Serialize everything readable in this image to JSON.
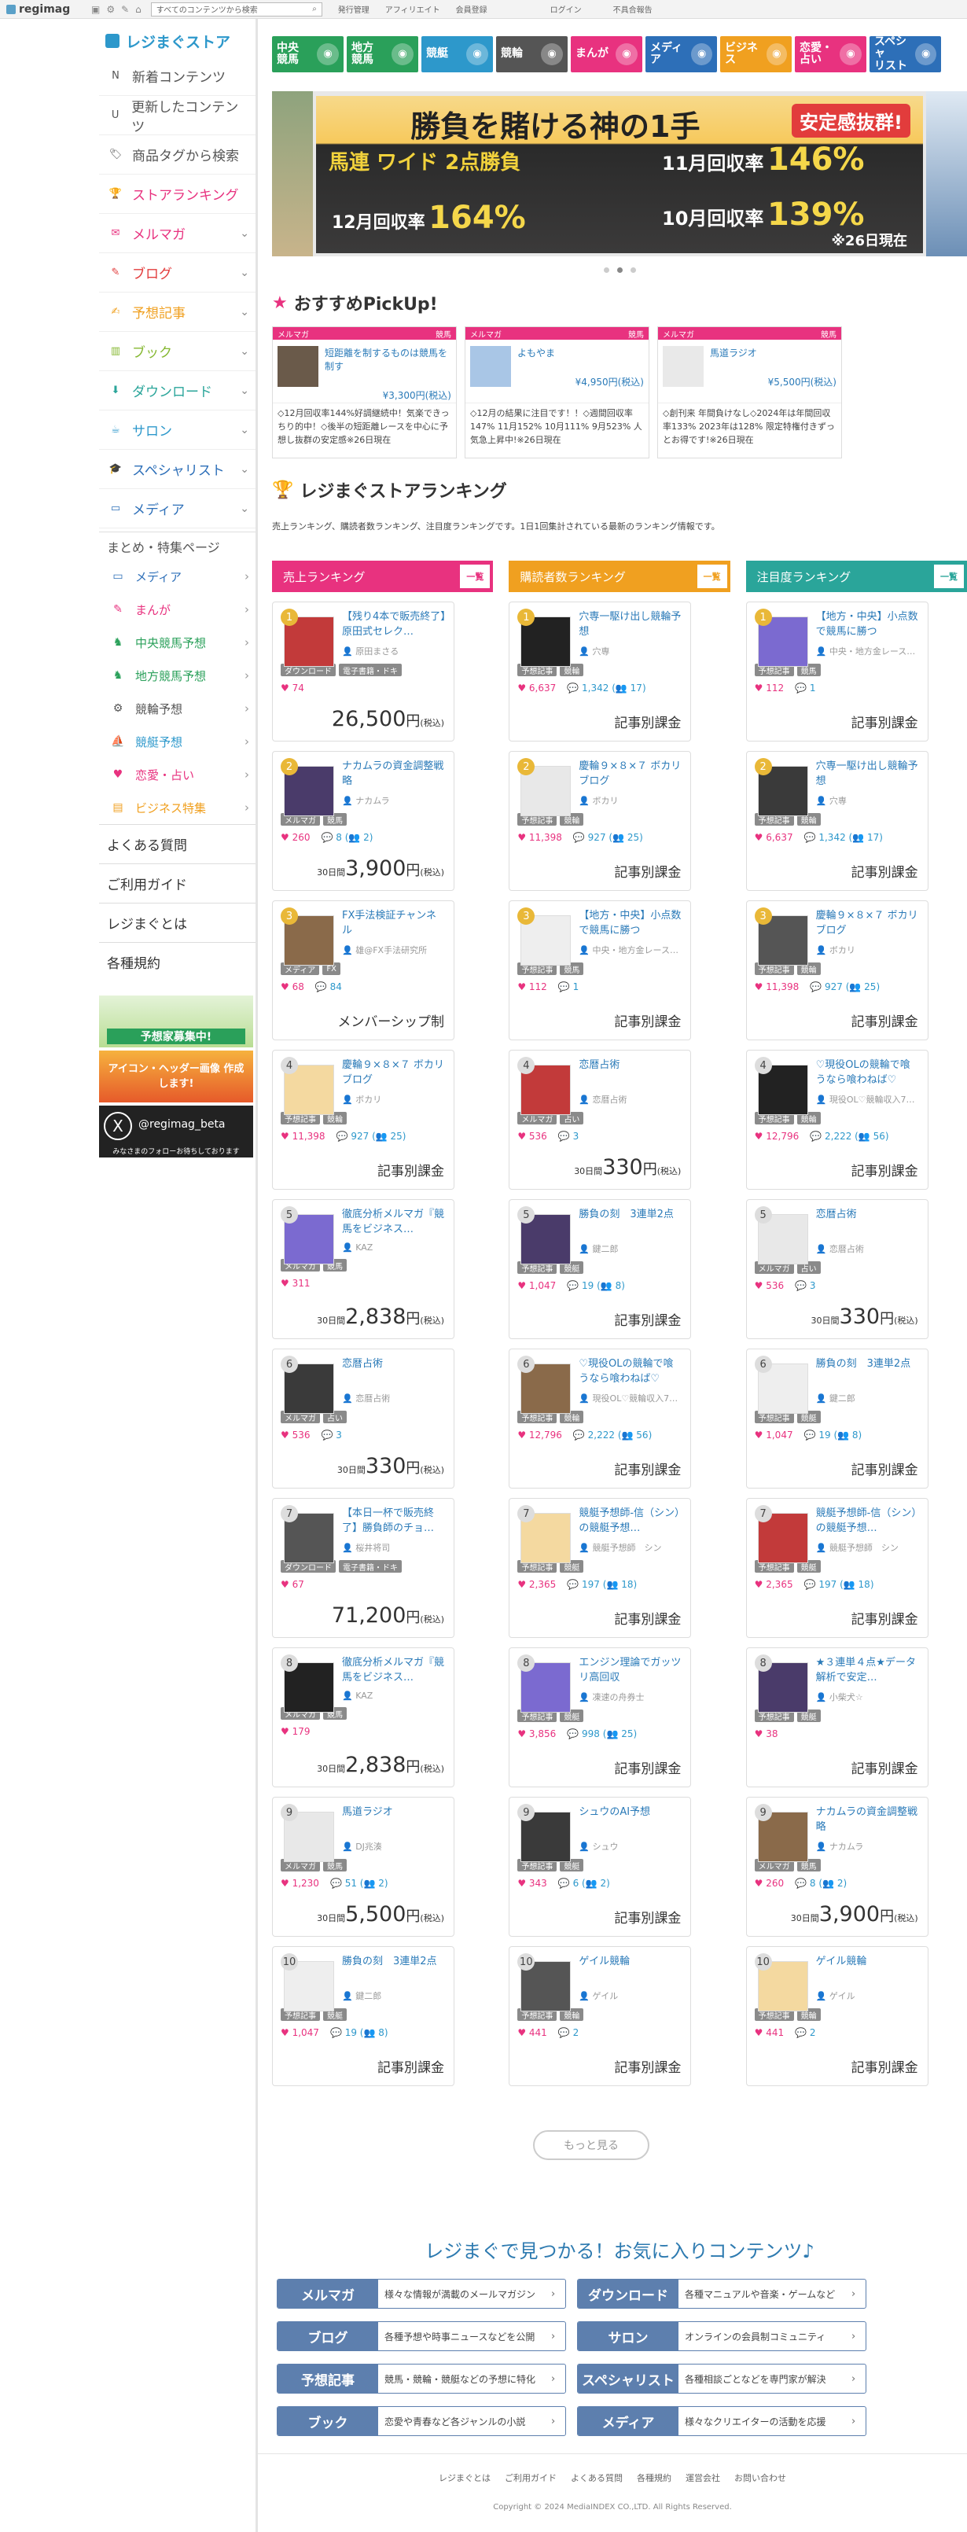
{
  "topbar": {
    "brand": "regimag",
    "search_placeholder": "すべてのコンテンツから検索",
    "links": [
      "発行管理",
      "アフィリエイト",
      "会員登録"
    ],
    "right": [
      "ログイン",
      "不具合報告"
    ]
  },
  "sidebar": {
    "logo": "レジまぐストア",
    "items": [
      {
        "label": "新着コンテンツ",
        "icon": "new-icon",
        "color": "#555"
      },
      {
        "label": "更新したコンテンツ",
        "icon": "update-icon",
        "color": "#555"
      },
      {
        "label": "商品タグから検索",
        "icon": "tag-icon",
        "color": "#555"
      },
      {
        "label": "ストアランキング",
        "icon": "trophy-icon",
        "color": "#e8327f"
      },
      {
        "label": "メルマガ",
        "icon": "mail-icon",
        "color": "#e8327f"
      },
      {
        "label": "ブログ",
        "icon": "pen-icon",
        "color": "#e23c3c"
      },
      {
        "label": "予想記事",
        "icon": "note-icon",
        "color": "#f0a020"
      },
      {
        "label": "ブック",
        "icon": "book-icon",
        "color": "#86b832"
      },
      {
        "label": "ダウンロード",
        "icon": "download-icon",
        "color": "#2aa59a"
      },
      {
        "label": "サロン",
        "icon": "cup-icon",
        "color": "#2d98cb"
      },
      {
        "label": "スペシャリスト",
        "icon": "cap-icon",
        "color": "#2d6fb8"
      },
      {
        "label": "メディア",
        "icon": "monitor-icon",
        "color": "#2d6fb8"
      }
    ],
    "special_heading": "まとめ・特集ページ",
    "special": [
      {
        "label": "メディア",
        "icon": "monitor-icon",
        "color": "#2d6fb8"
      },
      {
        "label": "まんが",
        "icon": "manga-icon",
        "color": "#e8327f"
      },
      {
        "label": "中央競馬予想",
        "icon": "horse-icon",
        "color": "#2aa05a"
      },
      {
        "label": "地方競馬予想",
        "icon": "horse-icon",
        "color": "#2aa05a"
      },
      {
        "label": "競輪予想",
        "icon": "bike-icon",
        "color": "#555"
      },
      {
        "label": "競艇予想",
        "icon": "boat-icon",
        "color": "#2d98cb"
      },
      {
        "label": "恋愛・占い",
        "icon": "heart-icon",
        "color": "#e8327f"
      },
      {
        "label": "ビジネス特集",
        "icon": "briefcase-icon",
        "color": "#f0a020"
      }
    ],
    "plain": [
      "よくある質問",
      "ご利用ガイド",
      "レジまぐとは",
      "各種規約"
    ],
    "banners": [
      "予想家募集中!",
      "アイコン・ヘッダー画像 作成します!",
      "@regimag_beta"
    ],
    "banner_sub": "みなさまのフォローお待ちしております"
  },
  "cats": [
    {
      "label": "中央\n競馬",
      "color": "#2aa05a"
    },
    {
      "label": "地方\n競馬",
      "color": "#2aa05a"
    },
    {
      "label": "競艇",
      "color": "#2d98cb"
    },
    {
      "label": "競輪",
      "color": "#555555"
    },
    {
      "label": "まんが",
      "color": "#e8327f"
    },
    {
      "label": "メディア",
      "color": "#2d6fb8"
    },
    {
      "label": "ビジネス",
      "color": "#f0a020"
    },
    {
      "label": "恋愛・\n占い",
      "color": "#e8327f"
    },
    {
      "label": "スペシャ\nリスト",
      "color": "#2d6fb8"
    }
  ],
  "hero": {
    "headline": "勝負を賭ける神の1手",
    "badge": "安定感抜群!",
    "sub": "馬連 ワイド 2点勝負",
    "s1": "11月回収率",
    "v1": "146%",
    "s2": "12月回収率",
    "v2": "164%",
    "s3": "10月回収率",
    "v3": "139%",
    "note": "※26日現在"
  },
  "pickup": {
    "title": "おすすめPickUp!",
    "items": [
      {
        "type": "メルマガ",
        "cat": "競馬",
        "title": "短距離を制するものは競馬を制す",
        "price": "¥3,300円(税込)",
        "desc": "◇12月回収率144%好調継続中！気楽できっちり的中！◇後半の短距離レースを中心に予想し抜群の安定感※26日現在"
      },
      {
        "type": "メルマガ",
        "cat": "競馬",
        "title": "よもやま",
        "price": "¥4,950円(税込)",
        "desc": "◇12月の結果に注目です！！◇週間回収率147% 11月152% 10月111% 9月523% 人気急上昇中!※26日現在"
      },
      {
        "type": "メルマガ",
        "cat": "競馬",
        "title": "馬道ラジオ",
        "price": "¥5,500円(税込)",
        "desc": "◇創刊来 年間負けなし◇2024年は年間回収率133% 2023年は128% 限定特権付きずっとお得です!※26日現在"
      }
    ]
  },
  "ranking": {
    "title": "レジまぐストアランキング",
    "desc": "売上ランキング、購読者数ランキング、注目度ランキングです。1日1回集計されている最新のランキング情報です。",
    "all": "一覧",
    "more": "もっと見る",
    "columns": [
      {
        "title": "売上ランキング",
        "color": "#e8327f",
        "cards": [
          {
            "r": "1",
            "name": "【残り4本で販売終了】原田式セレク…",
            "author": "原田まさる",
            "tags": [
              "ダウンロード",
              "電子書籍・ドキ"
            ],
            "h": "74",
            "c": "",
            "s": "",
            "price": "26,500",
            "pre": "",
            "unit": "円",
            "tax": "(税込)"
          },
          {
            "r": "2",
            "name": "ナカムラの資金調整戦略",
            "author": "ナカムラ",
            "tags": [
              "メルマガ",
              "競馬"
            ],
            "h": "260",
            "c": "8",
            "s": "2",
            "price": "3,900",
            "pre": "30日間",
            "unit": "円",
            "tax": "(税込)"
          },
          {
            "r": "3",
            "name": "FX手法検証チャンネル",
            "author": "雄@FX手法研究所",
            "tags": [
              "メディア",
              "FX"
            ],
            "h": "68",
            "c": "84",
            "s": "",
            "price": "メンバーシップ制",
            "pre": "",
            "unit": "",
            "tax": ""
          },
          {
            "r": "4",
            "name": "慶輪９×８×７ ボカリブログ",
            "author": "ボカリ",
            "tags": [
              "予想記事",
              "競輪"
            ],
            "h": "11,398",
            "c": "927",
            "s": "25",
            "price": "記事別課金",
            "pre": "",
            "unit": "",
            "tax": ""
          },
          {
            "r": "5",
            "name": "徹底分析メルマガ『競馬をビジネス…",
            "author": "KAZ",
            "tags": [
              "メルマガ",
              "競馬"
            ],
            "h": "311",
            "c": "",
            "s": "",
            "price": "2,838",
            "pre": "30日間",
            "unit": "円",
            "tax": "(税込)"
          },
          {
            "r": "6",
            "name": "恋暦占術",
            "author": "恋暦占術",
            "tags": [
              "メルマガ",
              "占い"
            ],
            "h": "536",
            "c": "3",
            "s": "",
            "price": "330",
            "pre": "30日間",
            "unit": "円",
            "tax": "(税込)"
          },
          {
            "r": "7",
            "name": "【本日一杯で販売終了】勝負師のチョ…",
            "author": "桜井将司",
            "tags": [
              "ダウンロード",
              "電子書籍・ドキ"
            ],
            "h": "67",
            "c": "",
            "s": "",
            "price": "71,200",
            "pre": "",
            "unit": "円",
            "tax": "(税込)"
          },
          {
            "r": "8",
            "name": "徹底分析メルマガ『競馬をビジネス…",
            "author": "KAZ",
            "tags": [
              "メルマガ",
              "競馬"
            ],
            "h": "179",
            "c": "",
            "s": "",
            "price": "2,838",
            "pre": "30日間",
            "unit": "円",
            "tax": "(税込)"
          },
          {
            "r": "9",
            "name": "馬道ラジオ",
            "author": "DJ兆湊",
            "tags": [
              "メルマガ",
              "競馬"
            ],
            "h": "1,230",
            "c": "51",
            "s": "2",
            "price": "5,500",
            "pre": "30日間",
            "unit": "円",
            "tax": "(税込)"
          },
          {
            "r": "10",
            "name": "勝負の刻　3連単2点",
            "author": "鍵二郎",
            "tags": [
              "予想記事",
              "競艇"
            ],
            "h": "1,047",
            "c": "19",
            "s": "8",
            "price": "記事別課金",
            "pre": "",
            "unit": "",
            "tax": ""
          }
        ]
      },
      {
        "title": "購読者数ランキング",
        "color": "#f0a020",
        "cards": [
          {
            "r": "1",
            "name": "穴専一駆け出し競輪予想",
            "author": "穴専",
            "tags": [
              "予想記事",
              "競輪"
            ],
            "h": "6,637",
            "c": "1,342",
            "s": "17",
            "price": "記事別課金",
            "pre": "",
            "unit": "",
            "tax": ""
          },
          {
            "r": "2",
            "name": "慶輪９×８×７ ボカリブログ",
            "author": "ボカリ",
            "tags": [
              "予想記事",
              "競輪"
            ],
            "h": "11,398",
            "c": "927",
            "s": "25",
            "price": "記事別課金",
            "pre": "",
            "unit": "",
            "tax": ""
          },
          {
            "r": "3",
            "name": "【地方・中央】小点数で競馬に勝つ",
            "author": "中央・地方金レース…",
            "tags": [
              "予想記事",
              "競馬"
            ],
            "h": "112",
            "c": "1",
            "s": "",
            "price": "記事別課金",
            "pre": "",
            "unit": "",
            "tax": ""
          },
          {
            "r": "4",
            "name": "恋暦占術",
            "author": "恋暦占術",
            "tags": [
              "メルマガ",
              "占い"
            ],
            "h": "536",
            "c": "3",
            "s": "",
            "price": "330",
            "pre": "30日間",
            "unit": "円",
            "tax": "(税込)"
          },
          {
            "r": "5",
            "name": "勝負の刻　3連単2点",
            "author": "鍵二郎",
            "tags": [
              "予想記事",
              "競艇"
            ],
            "h": "1,047",
            "c": "19",
            "s": "8",
            "price": "記事別課金",
            "pre": "",
            "unit": "",
            "tax": ""
          },
          {
            "r": "6",
            "name": "♡現役OLの競輪で喰うなら喰わねば♡",
            "author": "現役OL♡競輪収入7…",
            "tags": [
              "予想記事",
              "競輪"
            ],
            "h": "12,796",
            "c": "2,222",
            "s": "56",
            "price": "記事別課金",
            "pre": "",
            "unit": "",
            "tax": ""
          },
          {
            "r": "7",
            "name": "競艇予想師-信（シン）の競艇予想…",
            "author": "競艇予想師　シン",
            "tags": [
              "予想記事",
              "競艇"
            ],
            "h": "2,365",
            "c": "197",
            "s": "18",
            "price": "記事別課金",
            "pre": "",
            "unit": "",
            "tax": ""
          },
          {
            "r": "8",
            "name": "エンジン理論でガッツリ高回収",
            "author": "凍速の舟券士",
            "tags": [
              "予想記事",
              "競艇"
            ],
            "h": "3,856",
            "c": "998",
            "s": "25",
            "price": "記事別課金",
            "pre": "",
            "unit": "",
            "tax": ""
          },
          {
            "r": "9",
            "name": "シュウのAI予想",
            "author": "シュウ",
            "tags": [
              "予想記事",
              "競艇"
            ],
            "h": "343",
            "c": "6",
            "s": "2",
            "price": "記事別課金",
            "pre": "",
            "unit": "",
            "tax": ""
          },
          {
            "r": "10",
            "name": "ゲイル競輪",
            "author": "ゲイル",
            "tags": [
              "予想記事",
              "競輪"
            ],
            "h": "441",
            "c": "2",
            "s": "",
            "price": "記事別課金",
            "pre": "",
            "unit": "",
            "tax": ""
          }
        ]
      },
      {
        "title": "注目度ランキング",
        "color": "#2aa59a",
        "cards": [
          {
            "r": "1",
            "name": "【地方・中央】小点数で競馬に勝つ",
            "author": "中央・地方金レース…",
            "tags": [
              "予想記事",
              "競馬"
            ],
            "h": "112",
            "c": "1",
            "s": "",
            "price": "記事別課金",
            "pre": "",
            "unit": "",
            "tax": ""
          },
          {
            "r": "2",
            "name": "穴専一駆け出し競輪予想",
            "author": "穴専",
            "tags": [
              "予想記事",
              "競輪"
            ],
            "h": "6,637",
            "c": "1,342",
            "s": "17",
            "price": "記事別課金",
            "pre": "",
            "unit": "",
            "tax": ""
          },
          {
            "r": "3",
            "name": "慶輪９×８×７ ボカリブログ",
            "author": "ボカリ",
            "tags": [
              "予想記事",
              "競輪"
            ],
            "h": "11,398",
            "c": "927",
            "s": "25",
            "price": "記事別課金",
            "pre": "",
            "unit": "",
            "tax": ""
          },
          {
            "r": "4",
            "name": "♡現役OLの競輪で喰うなら喰わねば♡",
            "author": "現役OL♡競輪収入7…",
            "tags": [
              "予想記事",
              "競輪"
            ],
            "h": "12,796",
            "c": "2,222",
            "s": "56",
            "price": "記事別課金",
            "pre": "",
            "unit": "",
            "tax": ""
          },
          {
            "r": "5",
            "name": "恋暦占術",
            "author": "恋暦占術",
            "tags": [
              "メルマガ",
              "占い"
            ],
            "h": "536",
            "c": "3",
            "s": "",
            "price": "330",
            "pre": "30日間",
            "unit": "円",
            "tax": "(税込)"
          },
          {
            "r": "6",
            "name": "勝負の刻　3連単2点",
            "author": "鍵二郎",
            "tags": [
              "予想記事",
              "競艇"
            ],
            "h": "1,047",
            "c": "19",
            "s": "8",
            "price": "記事別課金",
            "pre": "",
            "unit": "",
            "tax": ""
          },
          {
            "r": "7",
            "name": "競艇予想師-信（シン）の競艇予想…",
            "author": "競艇予想師　シン",
            "tags": [
              "予想記事",
              "競艇"
            ],
            "h": "2,365",
            "c": "197",
            "s": "18",
            "price": "記事別課金",
            "pre": "",
            "unit": "",
            "tax": ""
          },
          {
            "r": "8",
            "name": "★３連単４点★データ解析で安定…",
            "author": "小柴犬☆",
            "tags": [
              "予想記事",
              "競艇"
            ],
            "h": "38",
            "c": "",
            "s": "",
            "price": "記事別課金",
            "pre": "",
            "unit": "",
            "tax": ""
          },
          {
            "r": "9",
            "name": "ナカムラの資金調整戦略",
            "author": "ナカムラ",
            "tags": [
              "メルマガ",
              "競馬"
            ],
            "h": "260",
            "c": "8",
            "s": "2",
            "price": "3,900",
            "pre": "30日間",
            "unit": "円",
            "tax": "(税込)"
          },
          {
            "r": "10",
            "name": "ゲイル競輪",
            "author": "ゲイル",
            "tags": [
              "予想記事",
              "競輪"
            ],
            "h": "441",
            "c": "2",
            "s": "",
            "price": "記事別課金",
            "pre": "",
            "unit": "",
            "tax": ""
          }
        ]
      }
    ]
  },
  "find": {
    "title": "レジまぐで見つかる！お気に入りコンテンツ♪",
    "items": [
      {
        "label": "メルマガ",
        "text": "様々な情報が満載のメールマガジン"
      },
      {
        "label": "ダウンロード",
        "text": "各種マニュアルや音楽・ゲームなど"
      },
      {
        "label": "ブログ",
        "text": "各種予想や時事ニュースなどを公開"
      },
      {
        "label": "サロン",
        "text": "オンラインの会員制コミュニティ"
      },
      {
        "label": "予想記事",
        "text": "競馬・競輪・競艇などの予想に特化"
      },
      {
        "label": "スペシャリスト",
        "text": "各種相談ごとなどを専門家が解決"
      },
      {
        "label": "ブック",
        "text": "恋愛や青春など各ジャンルの小説"
      },
      {
        "label": "メディア",
        "text": "様々なクリエイターの活動を応援"
      }
    ]
  },
  "footer": {
    "links": [
      "レジまぐとは",
      "ご利用ガイド",
      "よくある質問",
      "各種規約",
      "運営会社",
      "お問い合わせ"
    ],
    "copyright": "Copyright © 2024 MediaINDEX CO.,LTD. All Rights Reserved."
  }
}
